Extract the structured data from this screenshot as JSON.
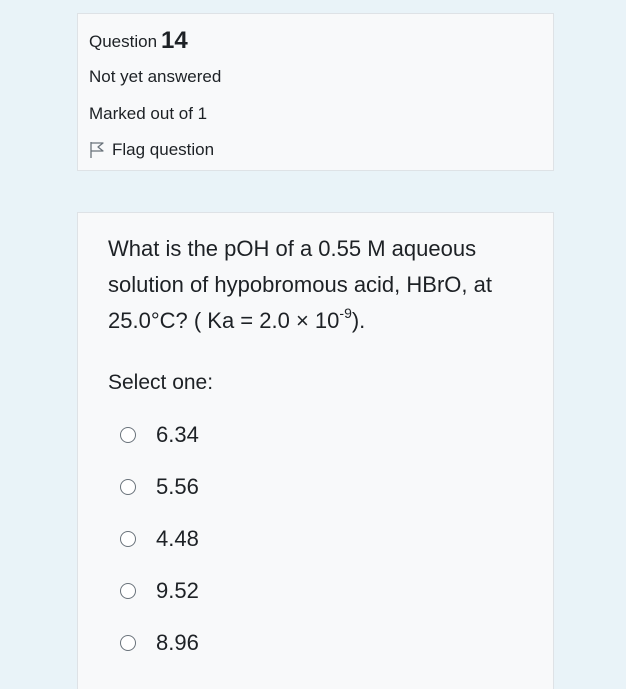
{
  "question_info": {
    "title": "Question",
    "number": "14",
    "state": "Not yet answered",
    "grade": "Marked out of 1",
    "flag_label": "Flag question"
  },
  "question": {
    "text_main": "What is the pOH of a 0.55 M aqueous solution of hypobromous acid, HBrO, at 25.0°C? ( Ka = 2.0 × 10",
    "text_exponent": "-9",
    "text_end": ").",
    "prompt": "Select one:",
    "answers": [
      {
        "label": "6.34",
        "selected": false
      },
      {
        "label": "5.56",
        "selected": false
      },
      {
        "label": "4.48",
        "selected": false
      },
      {
        "label": "9.52",
        "selected": false
      },
      {
        "label": "8.96",
        "selected": false
      }
    ]
  },
  "icons": {
    "flag": "flag-outline-icon",
    "radio": "radio-unchecked"
  },
  "colors": {
    "page_bg": "#e9f3f8",
    "box_bg": "#f8f9fa",
    "border": "#dee2e6",
    "text": "#1d2125"
  }
}
